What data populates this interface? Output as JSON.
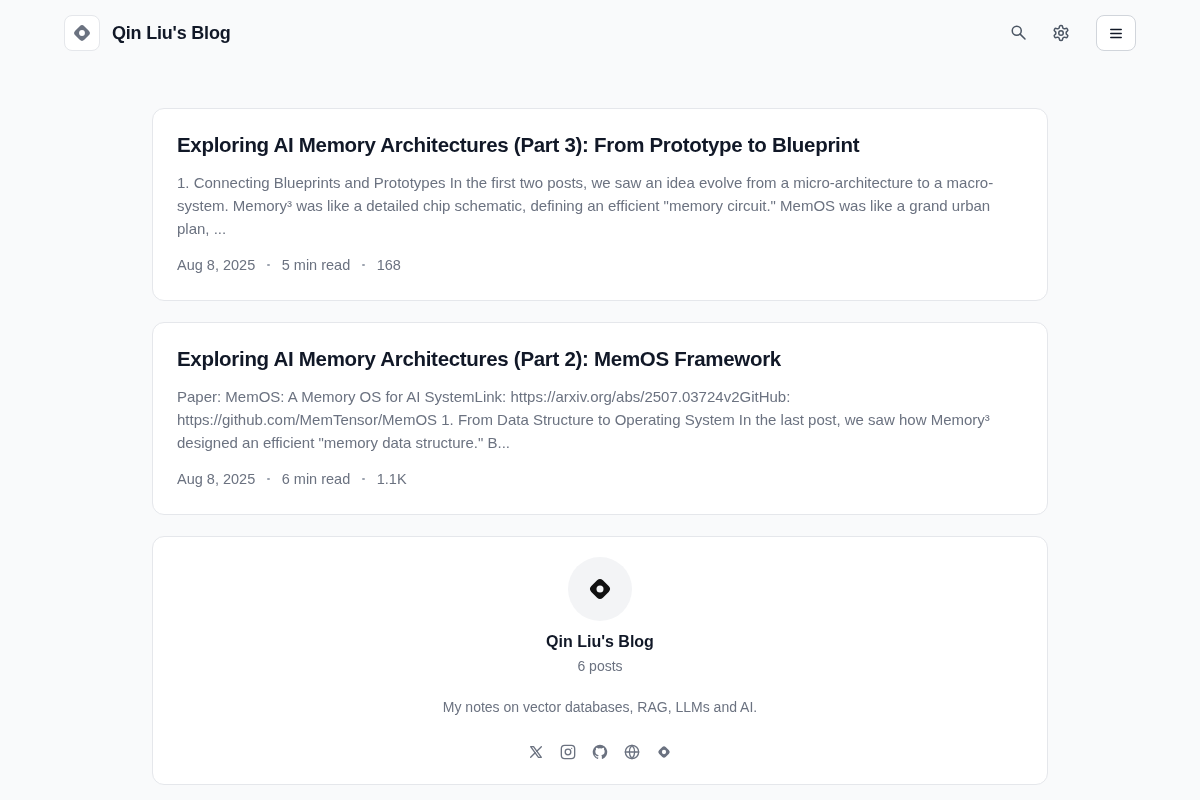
{
  "header": {
    "title": "Qin Liu's Blog"
  },
  "posts": [
    {
      "title": "Exploring AI Memory Architectures (Part 3): From Prototype to Blueprint",
      "excerpt": "1. Connecting Blueprints and Prototypes In the first two posts, we saw an idea evolve from a micro-architecture to a macro-system. Memory³ was like a detailed chip schematic, defining an efficient \"memory circuit.\" MemOS was like a grand urban plan, ...",
      "date": "Aug 8, 2025",
      "read_time": "5 min read",
      "views": "168"
    },
    {
      "title": "Exploring AI Memory Architectures (Part 2): MemOS Framework",
      "excerpt": "Paper: MemOS: A Memory OS for AI SystemLink: https://arxiv.org/abs/2507.03724v2GitHub: https://github.com/MemTensor/MemOS 1. From Data Structure to Operating System In the last post, we saw how Memory³ designed an efficient \"memory data structure.\" B...",
      "date": "Aug 8, 2025",
      "read_time": "6 min read",
      "views": "1.1K"
    }
  ],
  "profile": {
    "name": "Qin Liu's Blog",
    "post_count": "6 posts",
    "bio": "My notes on vector databases, RAG, LLMs and AI."
  }
}
